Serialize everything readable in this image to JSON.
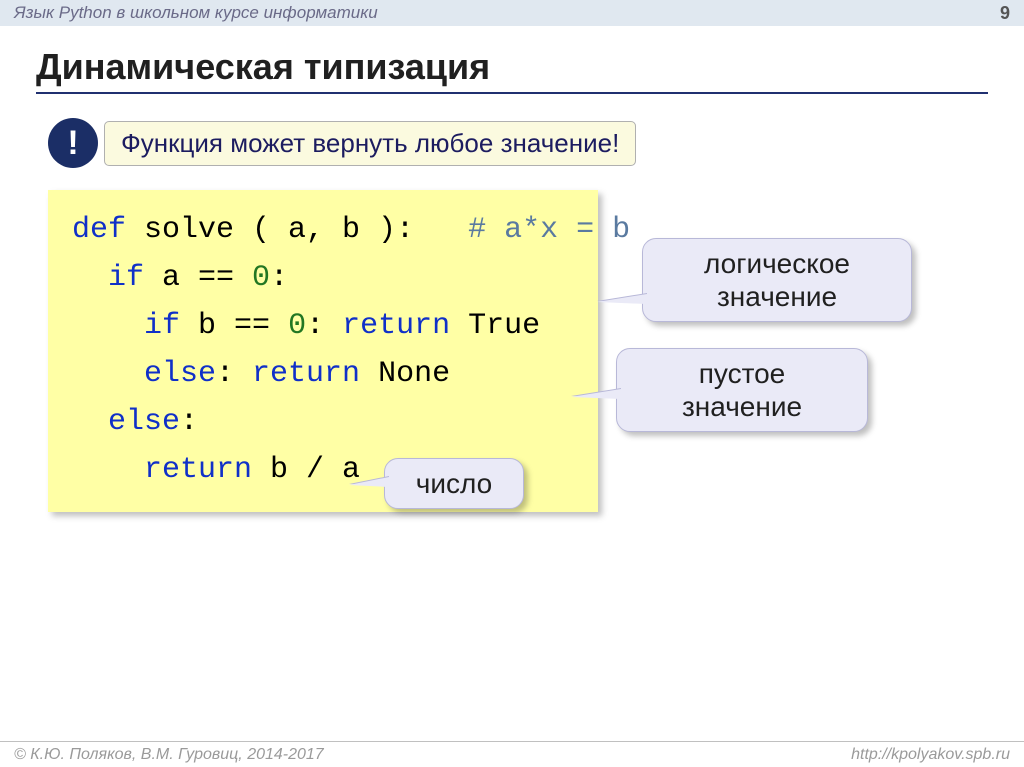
{
  "header": {
    "course": "Язык Python в школьном курсе информатики",
    "page": "9"
  },
  "title": "Динамическая типизация",
  "bang": "!",
  "callout": "Функция может вернуть любое значение!",
  "code": {
    "l1a": "def",
    "l1b": " solve ( a, b ):   ",
    "l1c": "# a*x = b",
    "l2a": "  if",
    "l2b": " a == ",
    "l2c": "0",
    "l2d": ":",
    "l3a": "    if",
    "l3b": " b == ",
    "l3c": "0",
    "l3d": ": ",
    "l3e": "return",
    "l3f": " True",
    "l4a": "    else",
    "l4b": ": ",
    "l4c": "return",
    "l4d": " None",
    "l5a": "  else",
    "l5b": ":",
    "l6a": "    return",
    "l6b": " b / a"
  },
  "bubbles": {
    "b1": "логическое значение",
    "b2": "пустое значение",
    "b3": "число"
  },
  "footer": {
    "left": "© К.Ю. Поляков, В.М. Гуровиц, 2014-2017",
    "right": "http://kpolyakov.spb.ru"
  }
}
